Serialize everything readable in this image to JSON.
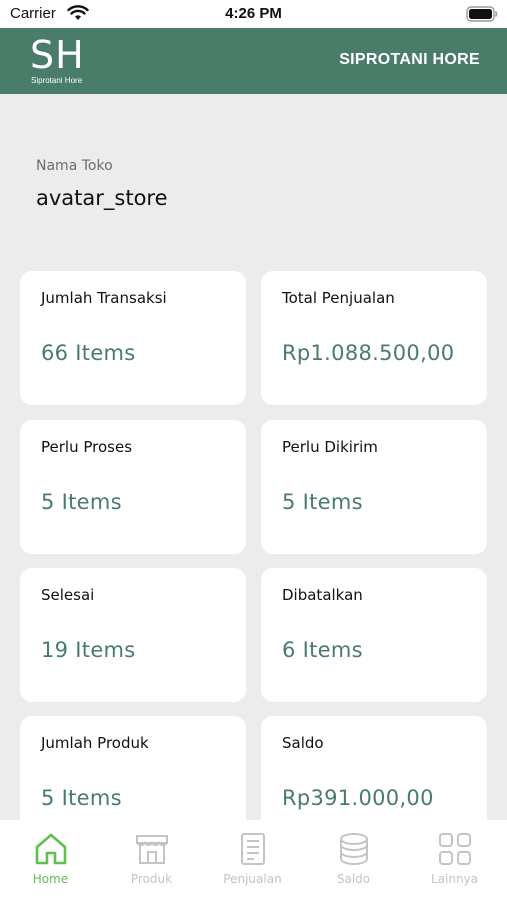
{
  "status_bar": {
    "carrier": "Carrier",
    "time": "4:26 PM"
  },
  "header": {
    "logo_mark": "SH",
    "logo_subtitle": "Siprotani Hore",
    "title": "SIPROTANI HORE"
  },
  "store": {
    "label": "Nama Toko",
    "name": "avatar_store"
  },
  "cards": [
    {
      "label": "Jumlah Transaksi",
      "value": "66 Items"
    },
    {
      "label": "Total Penjualan",
      "value": "Rp1.088.500,00"
    },
    {
      "label": "Perlu Proses",
      "value": "5 Items"
    },
    {
      "label": "Perlu Dikirim",
      "value": "5 Items"
    },
    {
      "label": "Selesai",
      "value": "19 Items"
    },
    {
      "label": "Dibatalkan",
      "value": "6 Items"
    },
    {
      "label": "Jumlah Produk",
      "value": "5 Items"
    },
    {
      "label": "Saldo",
      "value": "Rp391.000,00"
    }
  ],
  "tabs": [
    {
      "label": "Home",
      "icon": "home-icon",
      "active": true
    },
    {
      "label": "Produk",
      "icon": "store-icon",
      "active": false
    },
    {
      "label": "Penjualan",
      "icon": "receipt-icon",
      "active": false
    },
    {
      "label": "Saldo",
      "icon": "coins-icon",
      "active": false
    },
    {
      "label": "Lainnya",
      "icon": "grid-icon",
      "active": false
    }
  ],
  "colors": {
    "brand": "#4a7c6a",
    "active_tab": "#5fbf4f",
    "inactive_tab": "#c4c4c4",
    "background": "#ececec"
  }
}
